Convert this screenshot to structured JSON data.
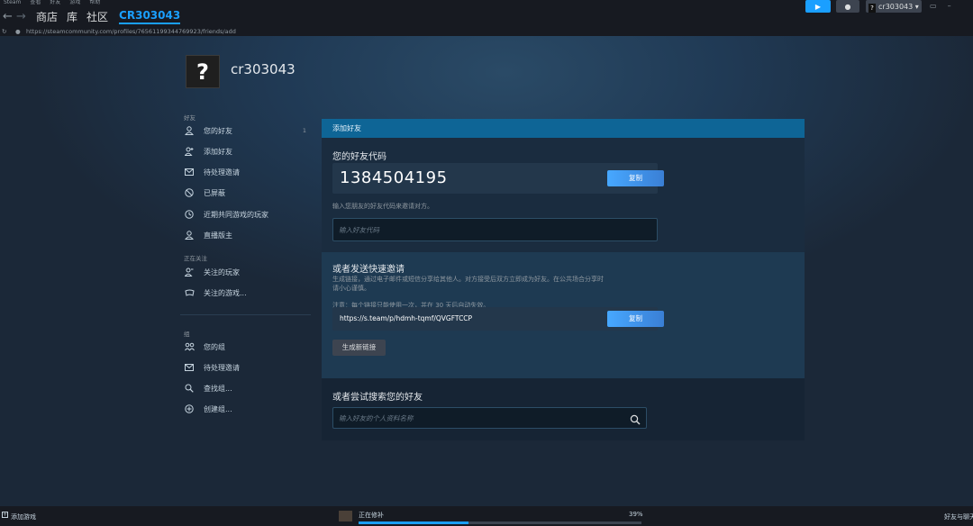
{
  "menubar": {
    "items": [
      "Steam",
      "查看",
      "好友",
      "游戏",
      "帮助"
    ]
  },
  "nav": {
    "back_icon": "arrow-left-icon",
    "forward_icon": "arrow-right-icon",
    "links": [
      "商店",
      "库",
      "社区"
    ],
    "active": "CR303043",
    "user_button": "cr303043"
  },
  "url": {
    "text": "https://steamcommunity.com/profiles/76561199344769923/friends/add"
  },
  "profile": {
    "avatar_glyph": "?",
    "name": "cr303043"
  },
  "sidebar": {
    "friends_header": "好友",
    "friends_items": [
      {
        "label": "您的好友",
        "count": "1",
        "icon": "person-icon"
      },
      {
        "label": "添加好友",
        "icon": "add-person-icon"
      },
      {
        "label": "待处理邀请",
        "icon": "envelope-icon"
      },
      {
        "label": "已屏蔽",
        "icon": "blocked-icon"
      },
      {
        "label": "近期共同游戏的玩家",
        "icon": "clock-icon"
      },
      {
        "label": "直播版主",
        "icon": "person-icon"
      }
    ],
    "following_header": "正在关注",
    "following_items": [
      {
        "label": "关注的玩家",
        "icon": "follow-person-icon"
      },
      {
        "label": "关注的游戏...",
        "icon": "gamepad-icon"
      }
    ],
    "groups_header": "组",
    "groups_items": [
      {
        "label": "您的组",
        "icon": "group-icon"
      },
      {
        "label": "待处理邀请",
        "icon": "envelope-icon"
      },
      {
        "label": "查找组...",
        "icon": "search-icon"
      },
      {
        "label": "创建组...",
        "icon": "plus-circle-icon"
      }
    ]
  },
  "panel": {
    "header": "添加好友",
    "friend_code_title": "您的好友代码",
    "friend_code": "1384504195",
    "copy_label": "复制",
    "code_hint": "输入您朋友的好友代码来邀请对方。",
    "code_input_placeholder": "输入好友代码",
    "quick_invite_title": "或者发送快速邀请",
    "quick_invite_desc_1": "生成链接，通过电子邮件或短信分享给其他人。对方接受后双方立即成为好友。在公共场合分享时",
    "quick_invite_desc_2": "请小心谨慎。",
    "quick_invite_note": "注意：每个链接只能使用一次，并在 30 天后自动失效。",
    "invite_link": "https://s.team/p/hdmh-tqmf/QVGFTCCP",
    "generate_label": "生成新链接",
    "search_title": "或者尝试搜索您的好友",
    "search_placeholder": "输入好友的个人资料名称"
  },
  "bottombar": {
    "add_game": "添加游戏",
    "status": "正在修补",
    "progress_percent": 39,
    "progress_text": "39%",
    "friends_chat": "好友与聊天"
  }
}
